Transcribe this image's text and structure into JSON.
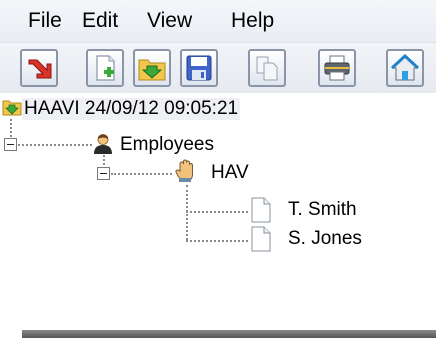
{
  "menu": {
    "items": [
      "File",
      "Edit",
      "View",
      "Help"
    ]
  },
  "toolbar": {
    "buttons": [
      {
        "icon": "exit-arrow-icon"
      },
      {
        "icon": "new-document-icon"
      },
      {
        "icon": "open-folder-icon"
      },
      {
        "icon": "save-floppy-icon"
      },
      {
        "icon": "copy-icon"
      },
      {
        "icon": "print-icon"
      },
      {
        "icon": "home-icon"
      }
    ]
  },
  "tree": {
    "root": {
      "label": "HAAVI 24/09/12 09:05:21",
      "icon": "folder-arrow-icon"
    },
    "group": {
      "label": "Employees",
      "icon": "person-icon"
    },
    "subgroup": {
      "label": "HAV",
      "icon": "hand-icon"
    },
    "leaves": [
      {
        "label": "T. Smith",
        "icon": "document-icon"
      },
      {
        "label": "S. Jones",
        "icon": "document-icon"
      }
    ]
  },
  "colors": {
    "accent_green": "#3aa83a",
    "accent_red": "#d8322a",
    "folder_yellow": "#f2c64a"
  }
}
